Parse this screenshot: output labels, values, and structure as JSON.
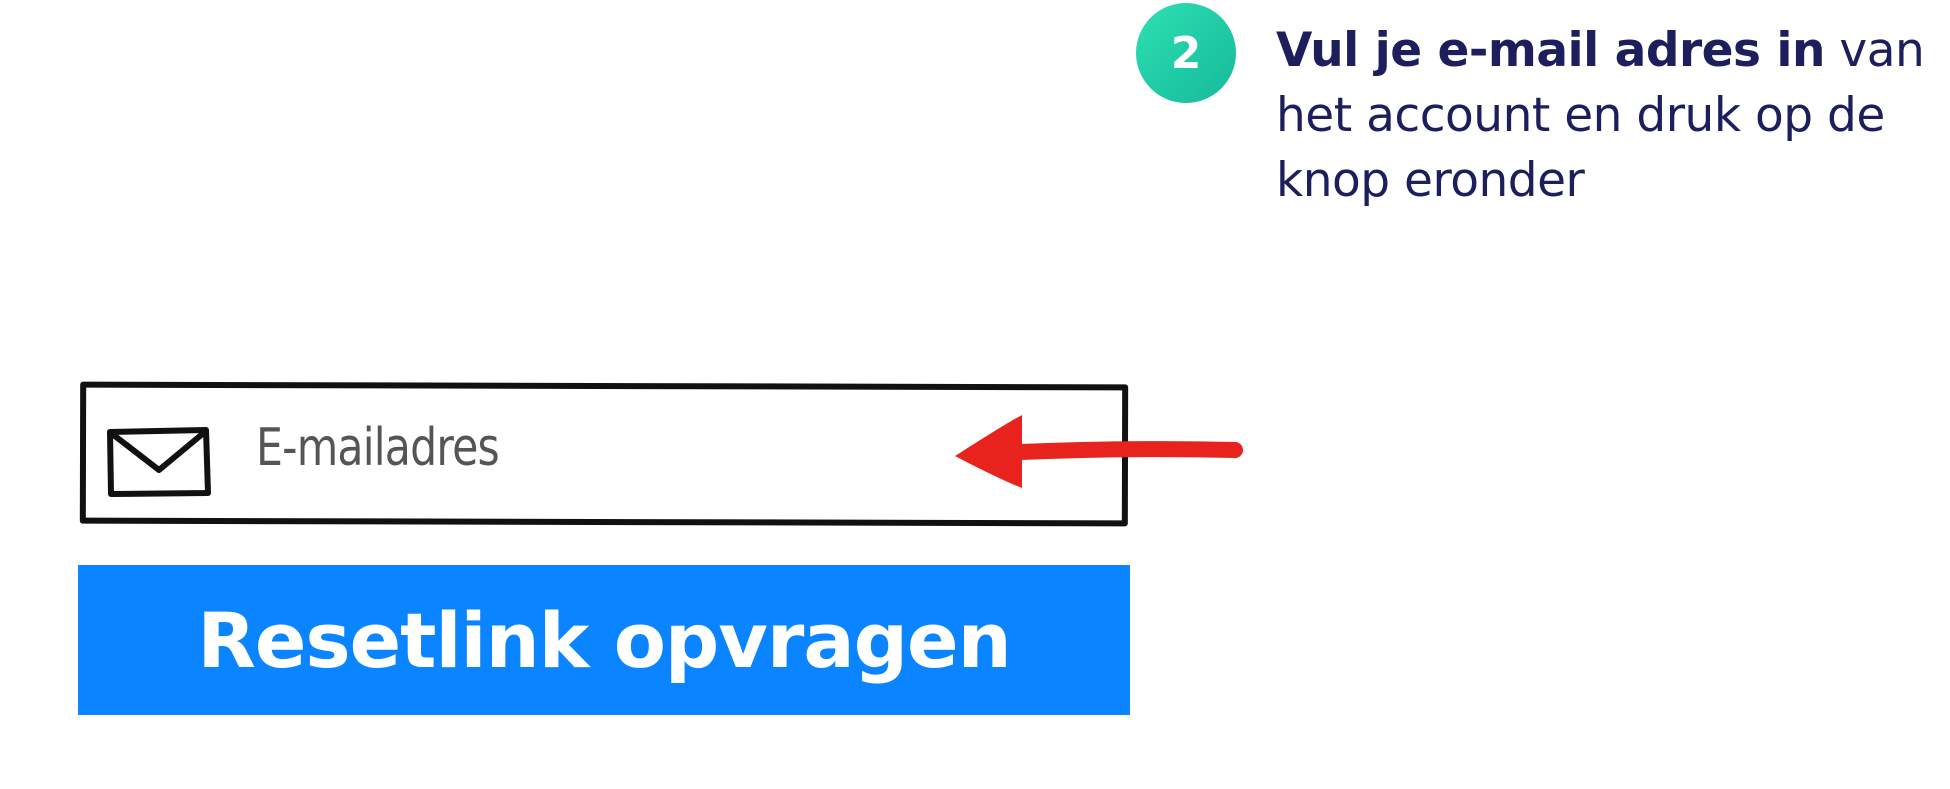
{
  "step": {
    "number": "2",
    "instruction_bold": "Vul je e-mail adres in",
    "instruction_rest": " van het account en druk op de knop eronder"
  },
  "form": {
    "email_placeholder": "E-mailadres",
    "submit_label": "Resetlink opvragen"
  },
  "icons": {
    "email": "envelope-icon",
    "pointer": "arrow-left-icon"
  },
  "colors": {
    "step_badge": "#1ec9a5",
    "instruction_text": "#1c1f5c",
    "button": "#0a84ff",
    "arrow": "#e8221c"
  }
}
